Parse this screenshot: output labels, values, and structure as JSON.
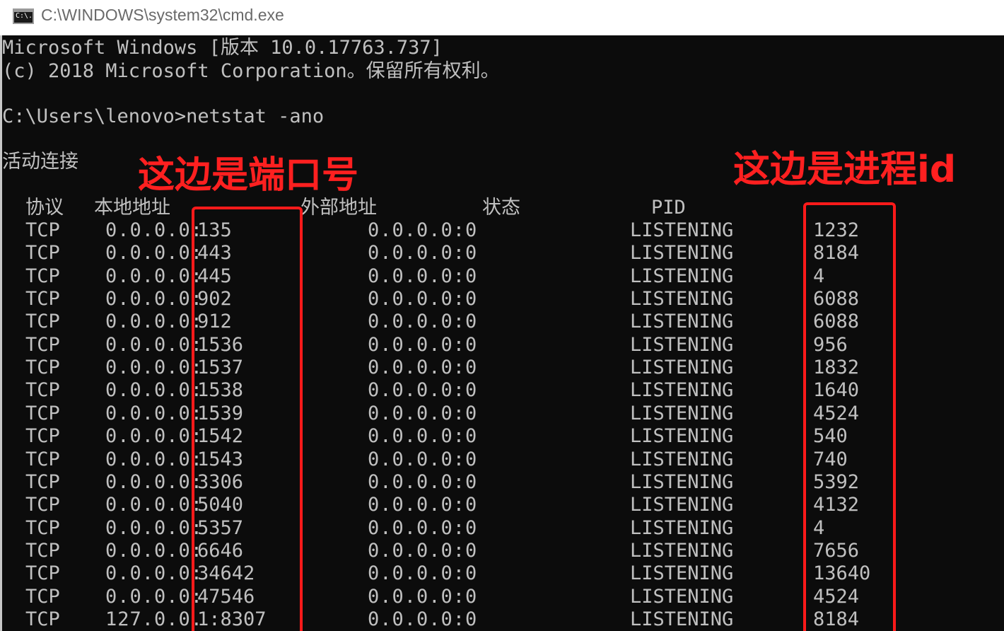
{
  "window": {
    "title": "C:\\WINDOWS\\system32\\cmd.exe",
    "icon": "cmd-icon",
    "icon_text": "C:\\."
  },
  "console": {
    "header_lines": [
      "Microsoft Windows [版本 10.0.17763.737]",
      "(c) 2018 Microsoft Corporation。保留所有权利。",
      "",
      "C:\\Users\\lenovo>netstat -ano",
      "",
      "活动连接"
    ],
    "columns": {
      "proto": "协议",
      "local": "本地地址",
      "foreign": "外部地址",
      "state": "状态",
      "pid": "PID"
    },
    "rows": [
      {
        "proto": "TCP",
        "local": "0.0.0.0:",
        "port": "135",
        "foreign": "0.0.0.0:0",
        "state": "LISTENING",
        "pid": "1232"
      },
      {
        "proto": "TCP",
        "local": "0.0.0.0:",
        "port": "443",
        "foreign": "0.0.0.0:0",
        "state": "LISTENING",
        "pid": "8184"
      },
      {
        "proto": "TCP",
        "local": "0.0.0.0:",
        "port": "445",
        "foreign": "0.0.0.0:0",
        "state": "LISTENING",
        "pid": "4"
      },
      {
        "proto": "TCP",
        "local": "0.0.0.0:",
        "port": "902",
        "foreign": "0.0.0.0:0",
        "state": "LISTENING",
        "pid": "6088"
      },
      {
        "proto": "TCP",
        "local": "0.0.0.0:",
        "port": "912",
        "foreign": "0.0.0.0:0",
        "state": "LISTENING",
        "pid": "6088"
      },
      {
        "proto": "TCP",
        "local": "0.0.0.0:",
        "port": "1536",
        "foreign": "0.0.0.0:0",
        "state": "LISTENING",
        "pid": "956"
      },
      {
        "proto": "TCP",
        "local": "0.0.0.0:",
        "port": "1537",
        "foreign": "0.0.0.0:0",
        "state": "LISTENING",
        "pid": "1832"
      },
      {
        "proto": "TCP",
        "local": "0.0.0.0:",
        "port": "1538",
        "foreign": "0.0.0.0:0",
        "state": "LISTENING",
        "pid": "1640"
      },
      {
        "proto": "TCP",
        "local": "0.0.0.0:",
        "port": "1539",
        "foreign": "0.0.0.0:0",
        "state": "LISTENING",
        "pid": "4524"
      },
      {
        "proto": "TCP",
        "local": "0.0.0.0:",
        "port": "1542",
        "foreign": "0.0.0.0:0",
        "state": "LISTENING",
        "pid": "540"
      },
      {
        "proto": "TCP",
        "local": "0.0.0.0:",
        "port": "1543",
        "foreign": "0.0.0.0:0",
        "state": "LISTENING",
        "pid": "740"
      },
      {
        "proto": "TCP",
        "local": "0.0.0.0:",
        "port": "3306",
        "foreign": "0.0.0.0:0",
        "state": "LISTENING",
        "pid": "5392"
      },
      {
        "proto": "TCP",
        "local": "0.0.0.0:",
        "port": "5040",
        "foreign": "0.0.0.0:0",
        "state": "LISTENING",
        "pid": "4132"
      },
      {
        "proto": "TCP",
        "local": "0.0.0.0:",
        "port": "5357",
        "foreign": "0.0.0.0:0",
        "state": "LISTENING",
        "pid": "4"
      },
      {
        "proto": "TCP",
        "local": "0.0.0.0:",
        "port": "6646",
        "foreign": "0.0.0.0:0",
        "state": "LISTENING",
        "pid": "7656"
      },
      {
        "proto": "TCP",
        "local": "0.0.0.0:",
        "port": "34642",
        "foreign": "0.0.0.0:0",
        "state": "LISTENING",
        "pid": "13640"
      },
      {
        "proto": "TCP",
        "local": "0.0.0.0:",
        "port": "47546",
        "foreign": "0.0.0.0:0",
        "state": "LISTENING",
        "pid": "4524"
      },
      {
        "proto": "TCP",
        "local": "127.0.0.",
        "port": "1:8307",
        "foreign": "0.0.0.0:0",
        "state": "LISTENING",
        "pid": "8184"
      }
    ]
  },
  "annotations": {
    "port_note": "这边是端口号",
    "pid_note": "这边是进程id",
    "color": "#ff1a1a"
  },
  "colors": {
    "console_bg": "#0c0c0c",
    "console_text": "#c0c0c0",
    "title_text": "#6a6a6a"
  }
}
